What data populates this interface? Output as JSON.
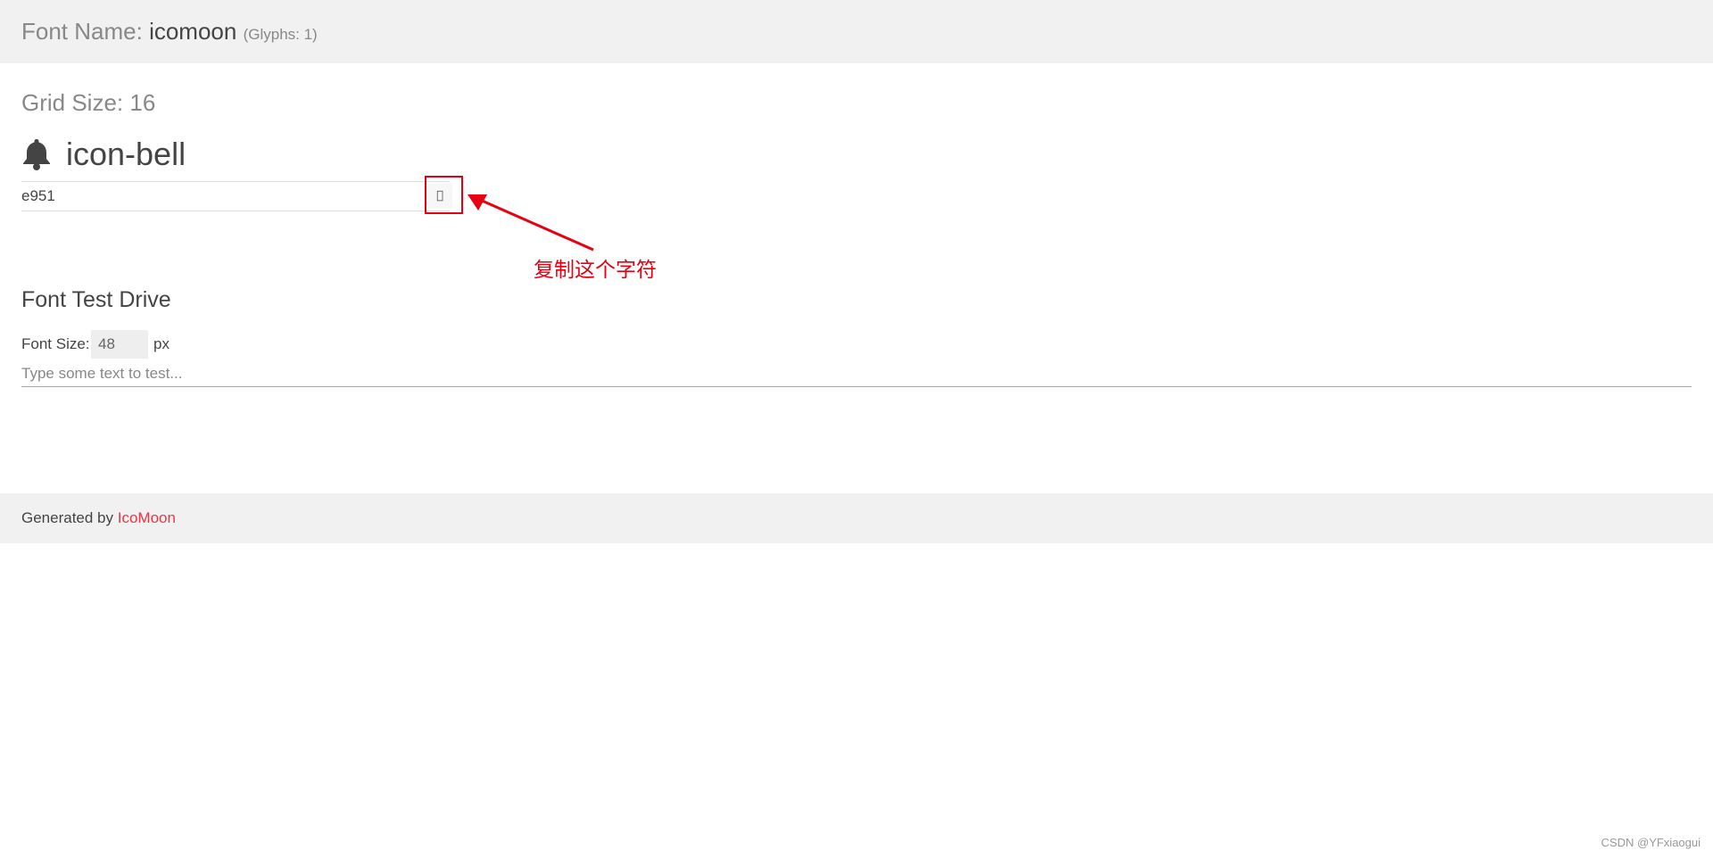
{
  "header": {
    "font_name_label": "Font Name:",
    "font_name_value": "icomoon",
    "glyph_count": "(Glyphs: 1)"
  },
  "grid": {
    "label": "Grid Size: 16"
  },
  "glyph": {
    "icon": "bell-icon",
    "name": "icon-bell",
    "code": "e951",
    "char": ""
  },
  "annotation": {
    "text": "复制这个字符",
    "color": "#e60012"
  },
  "test_drive": {
    "title": "Font Test Drive",
    "font_size_label": "Font Size:",
    "font_size_value": "48",
    "unit": "px",
    "placeholder": "Type some text to test..."
  },
  "footer": {
    "generated_by": "Generated by",
    "link_text": "IcoMoon",
    "link_color": "#e63946"
  },
  "watermark": "CSDN @YFxiaogui"
}
